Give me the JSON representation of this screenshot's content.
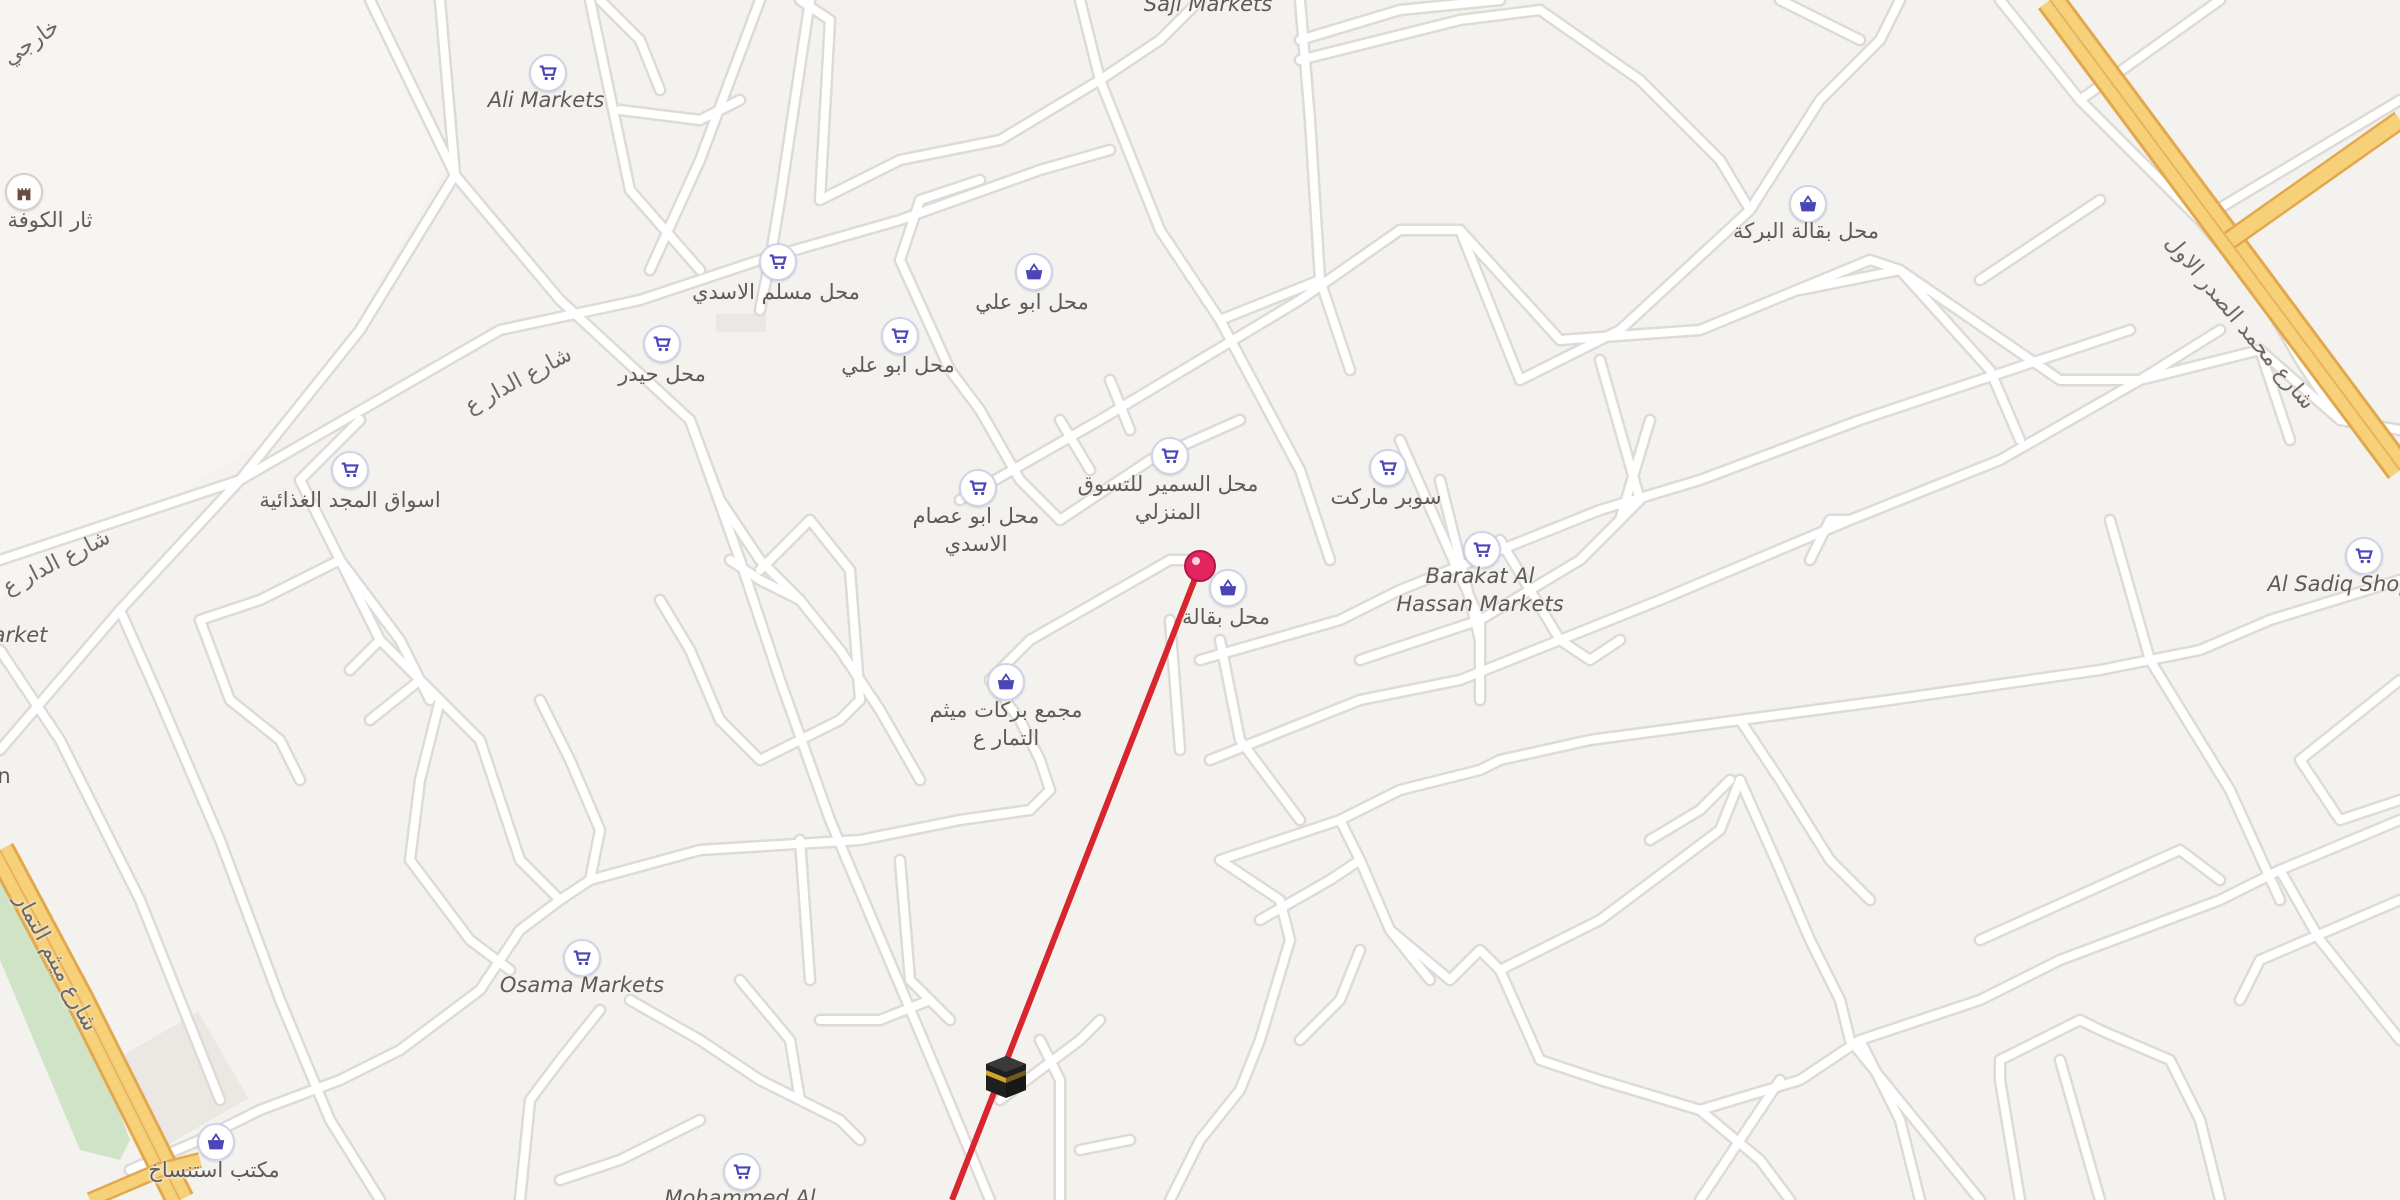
{
  "map": {
    "colors": {
      "land": "#f4f2ef",
      "road": "#ffffff",
      "road_casing": "#dedad5",
      "highway": "#f7d17a",
      "highway_casing": "#e3a84d",
      "park": "#cfe3c6",
      "direction_line": "#d7262e",
      "pin": "#e2245f",
      "poi_icon": "#4b46b8",
      "label_text": "#5e5a57"
    },
    "pois": [
      {
        "icon": "shopping-cart-icon",
        "label": "Ali Markets",
        "latin": true
      },
      {
        "icon": "fortress-icon",
        "label": "ثار الكوفة",
        "latin": false
      },
      {
        "icon": "shopping-cart-icon",
        "label": "محل مسلم الاسدي",
        "latin": false
      },
      {
        "icon": "shopping-basket-icon",
        "label": "محل ابو علي",
        "latin": false
      },
      {
        "icon": "shopping-cart-icon",
        "label": "محل ابو علي",
        "latin": false
      },
      {
        "icon": "shopping-cart-icon",
        "label": "محل حيدر",
        "latin": false
      },
      {
        "icon": "shopping-cart-icon",
        "label": "اسواق المجد الغذائية",
        "latin": false
      },
      {
        "icon": "shopping-cart-icon",
        "label": "محل ابو عصام الاسدي",
        "latin": false
      },
      {
        "icon": "shopping-cart-icon",
        "label": "محل السمير للتسوق المنزلي",
        "latin": false
      },
      {
        "icon": "shopping-basket-icon",
        "label": "محل بقالة",
        "latin": false
      },
      {
        "icon": "shopping-cart-icon",
        "label": "سوبر ماركت",
        "latin": false
      },
      {
        "icon": "shopping-cart-icon",
        "label": "Barakat Al Hassan Markets",
        "latin": true
      },
      {
        "icon": "shopping-basket-icon",
        "label": "محل بقالة البركة",
        "latin": false
      },
      {
        "icon": "shopping-cart-icon",
        "label": "Al Sadiq Shop",
        "latin": true
      },
      {
        "icon": "shopping-basket-icon",
        "label": "مجمع بركات ميثم التمار ع",
        "latin": false
      },
      {
        "icon": "shopping-cart-icon",
        "label": "Osama Markets",
        "latin": true
      },
      {
        "icon": "shopping-basket-icon",
        "label": "مكتب استنساخ",
        "latin": false
      },
      {
        "icon": "shopping-cart-icon",
        "label": "Mohammed Al",
        "latin": true
      }
    ],
    "partial_labels": [
      {
        "label": "Saji Markets"
      },
      {
        "label": "arket"
      },
      {
        "label": "n"
      }
    ],
    "streets": [
      {
        "label": "شارع الدار ع"
      },
      {
        "label": "شارع الدار ع"
      },
      {
        "label": "شارع محمد الصدر الاول"
      },
      {
        "label": "شارع ميثم التمار"
      },
      {
        "label": "خارجي"
      }
    ],
    "markers": {
      "pin": {
        "name": "location-pin-icon"
      },
      "qibla": {
        "name": "kaaba-icon"
      }
    }
  }
}
